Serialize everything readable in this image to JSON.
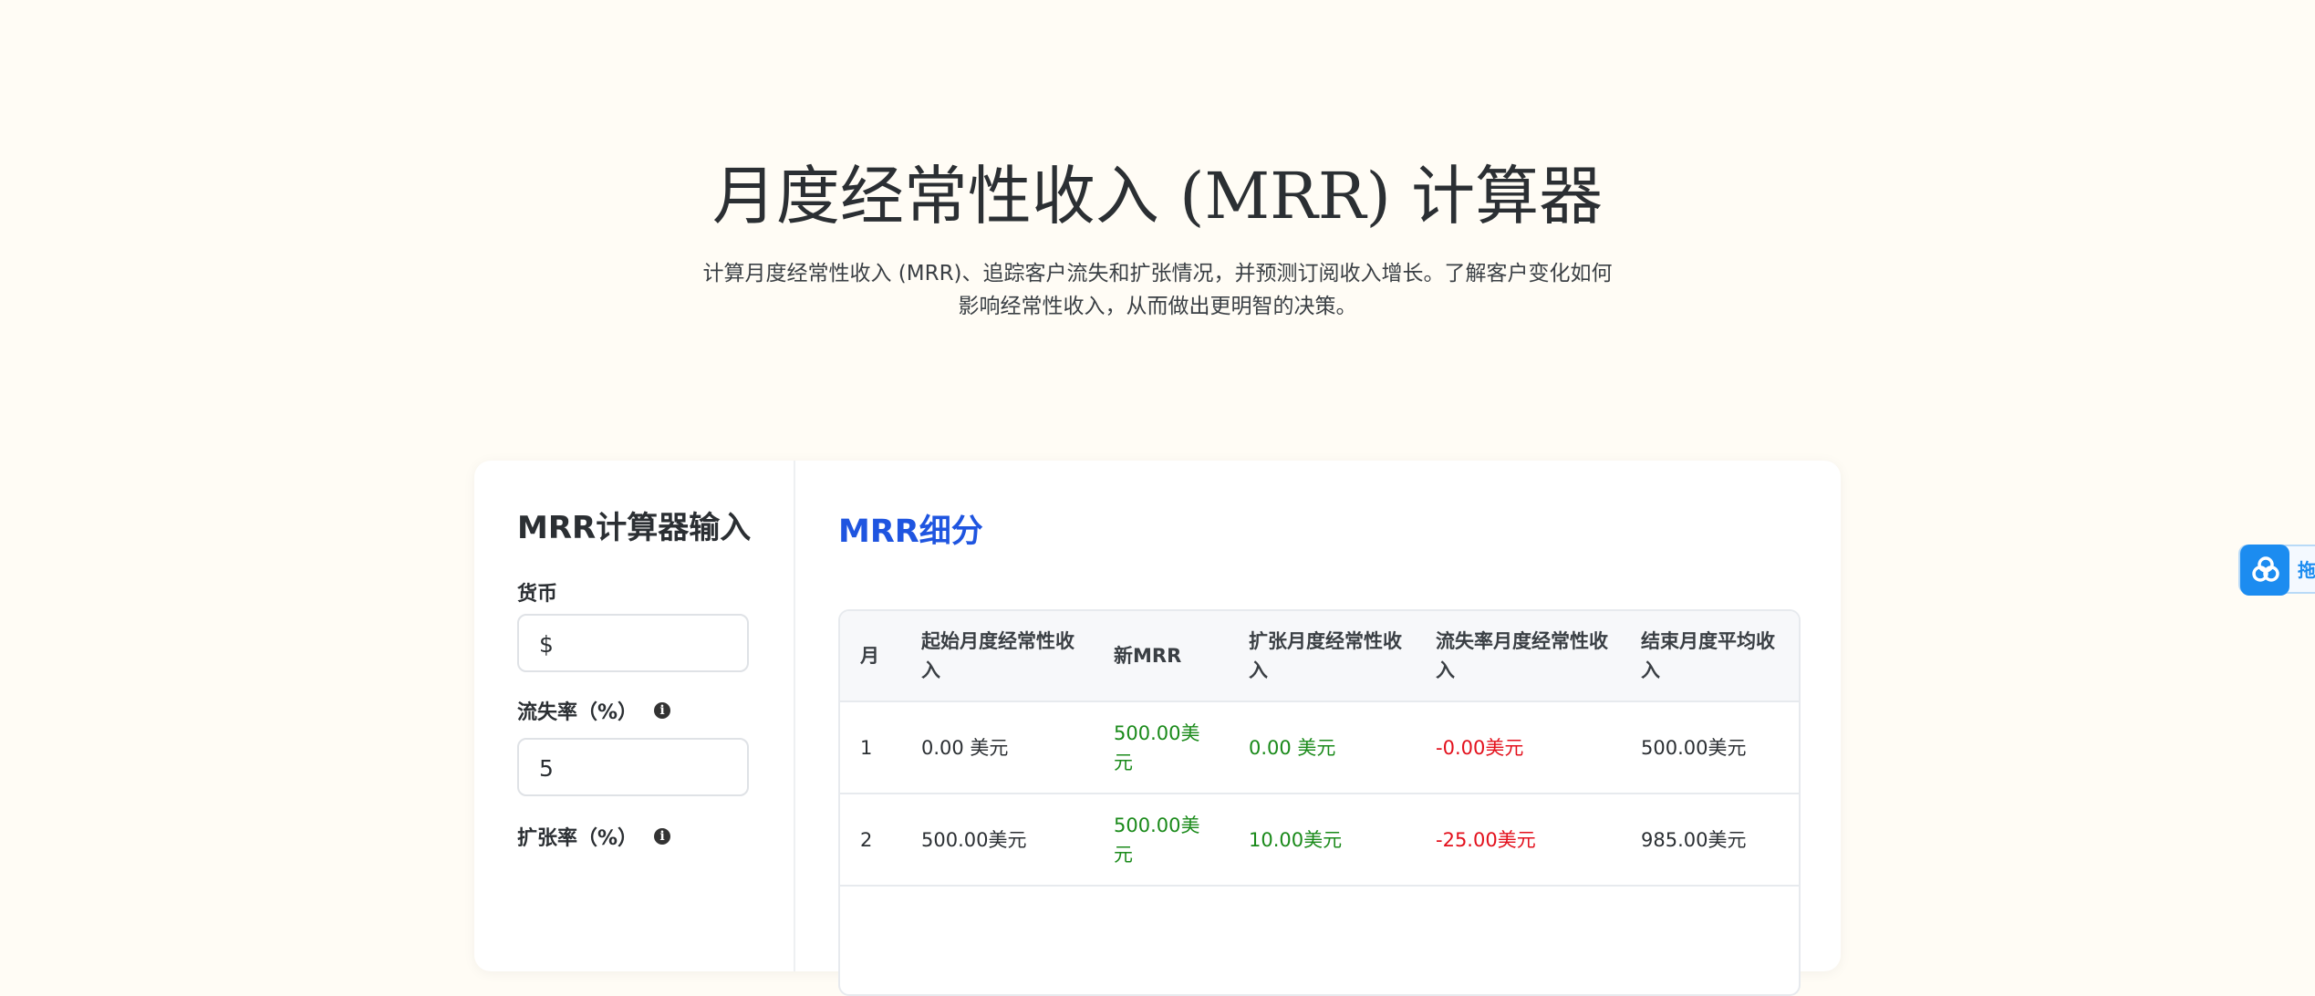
{
  "hero": {
    "title": "月度经常性收入 (MRR) 计算器",
    "description": "计算月度经常性收入 (MRR)、追踪客户流失和扩张情况，并预测订阅收入增长。了解客户变化如何影响经常性收入，从而做出更明智的决策。"
  },
  "inputs": {
    "heading": "MRR计算器输入",
    "currency_label": "货币",
    "currency_value": "$",
    "churn_label": "流失率（%）",
    "churn_value": "5",
    "expansion_label": "扩张率（%）",
    "info_icon": "info-icon"
  },
  "breakdown": {
    "heading": "MRR细分",
    "columns": [
      "月",
      "起始月度经常性收入",
      "新MRR",
      "扩张月度经常性收入",
      "流失率月度经常性收入",
      "结束月度平均收入"
    ],
    "rows": [
      {
        "month": "1",
        "start": "0.00 美元",
        "new": "500.00美元",
        "expansion": "0.00 美元",
        "churn": "-0.00美元",
        "end": "500.00美元"
      },
      {
        "month": "2",
        "start": "500.00美元",
        "new": "500.00美元",
        "expansion": "10.00美元",
        "churn": "-25.00美元",
        "end": "985.00美元"
      }
    ]
  },
  "floating_button": {
    "label": "拖",
    "icon": "app-logo-icon"
  },
  "colors": {
    "background": "#fffcf5",
    "accent_blue": "#1f55e0",
    "positive_green": "#1a8a1a",
    "negative_red": "#e3101c",
    "floating_blue": "#1c8cf0"
  }
}
